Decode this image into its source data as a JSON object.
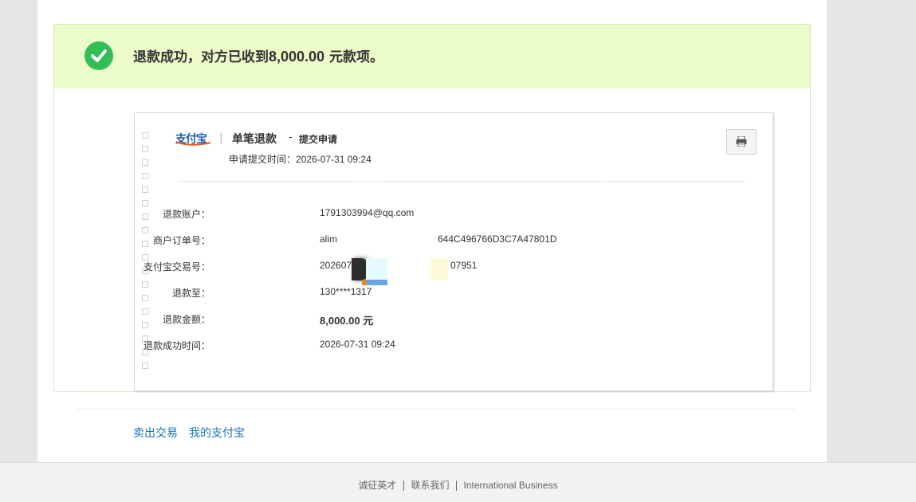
{
  "banner": {
    "message_prefix": "退款成功，对方已收到",
    "amount": "8,000.00",
    "message_suffix": " 元款项。",
    "color": "#ebfcca",
    "icon": "check-circle-icon"
  },
  "receipt": {
    "logo_text": "支付宝",
    "separator": "|",
    "title": "单笔退款",
    "dash": "-",
    "subtitle": "提交申请",
    "submit_time_label": "申请提交时间：",
    "submit_time": "2026-07-31 09:24",
    "print_icon": "printer-icon",
    "rows": [
      {
        "label": "退款账户：",
        "value": "1791303994@qq.com"
      },
      {
        "label": "商户订单号：",
        "value_start": "alim",
        "value_end": "644C496766D3C7A47801D"
      },
      {
        "label": "支付宝交易号：",
        "value_start": "202607",
        "value_end": "07951"
      },
      {
        "label": "退款至：",
        "value": "130****1317"
      },
      {
        "label": "退款金额：",
        "value": "8,000.00 元"
      },
      {
        "label": "退款成功时间：",
        "value": "2026-07-31 09:24"
      }
    ]
  },
  "links": {
    "sell_trade": "卖出交易",
    "my_alipay": "我的支付宝"
  },
  "footer": {
    "link1": "诚征英才",
    "link2": "联系我们",
    "link3": "International Business",
    "sep": "|"
  }
}
